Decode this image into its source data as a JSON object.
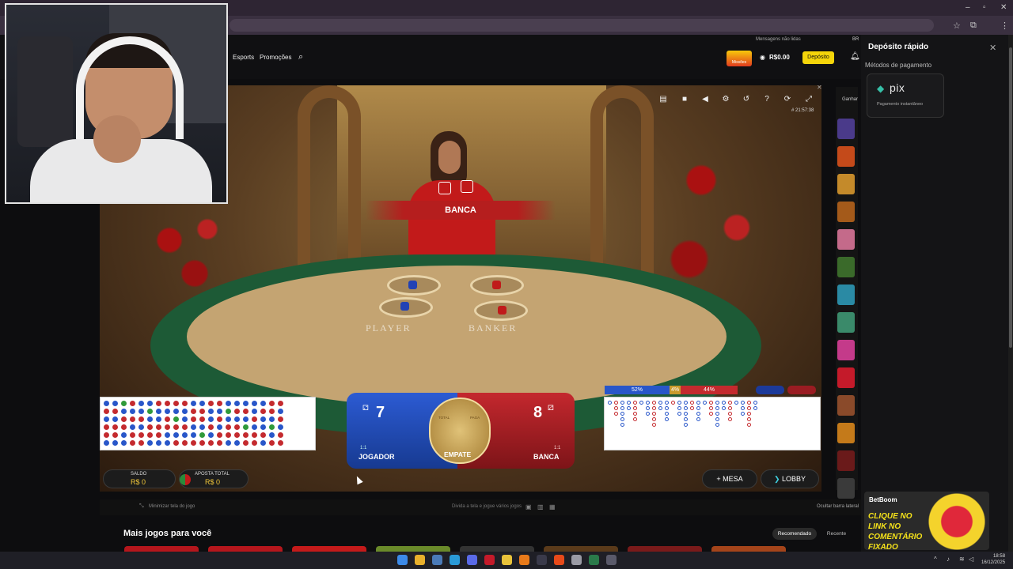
{
  "header": {
    "nav_esports": "Esports",
    "nav_promocoes": "Promoções",
    "notice": "Mensagens não lidas",
    "balance": "R$0.00",
    "deposit_label": "Depósito",
    "missoes_label": "Missões",
    "region": "BR"
  },
  "drawer": {
    "title": "Depósito rápido",
    "subtitle": "Métodos de pagamento",
    "method_name": "pix",
    "method_desc": "Pagamento instantâneo"
  },
  "game": {
    "banner": "BANCA",
    "table_player": "PLAYER",
    "table_banker": "BANKER",
    "clock": "# 21:57:38",
    "player_score": "7",
    "banker_score": "8",
    "player_label": "JOGADOR",
    "banker_label": "BANCA",
    "tie_label": "EMPATE",
    "player_odds": "1:1",
    "banker_odds": "1:1",
    "tie_total_header": "TOTAL",
    "tie_paga_header": "PAGA",
    "stats": {
      "player_pct": "52%",
      "tie_pct": "4%",
      "banker_pct": "44%"
    },
    "saldo_label": "SALDO",
    "saldo_value": "R$ 0",
    "aposta_label": "APOSTA TOTAL",
    "aposta_value": "R$ 0",
    "mesa_label": "MESA",
    "lobby_label": "LOBBY",
    "ganhar_label": "Ganhar"
  },
  "below": {
    "minimize": "Minimizar tela do jogo",
    "divide": "Divida a tela e jogue vários jogos",
    "hide": "Ocultar barra lateral",
    "more_title": "Mais jogos para você",
    "tab_recommended": "Recomendado",
    "tab_recent": "Recente"
  },
  "ad": {
    "brand": "BetBoom",
    "text": "CLIQUE NO LINK NO COMENTÁRIO FIXADO"
  },
  "taskbar": {
    "time": "18:58",
    "date": "16/12/2025"
  },
  "colors": {
    "player_blue": "#2c5bd3",
    "banker_red": "#c4282e",
    "tie_gold": "#c89a2c",
    "deposit_yellow": "#f5d50a"
  }
}
